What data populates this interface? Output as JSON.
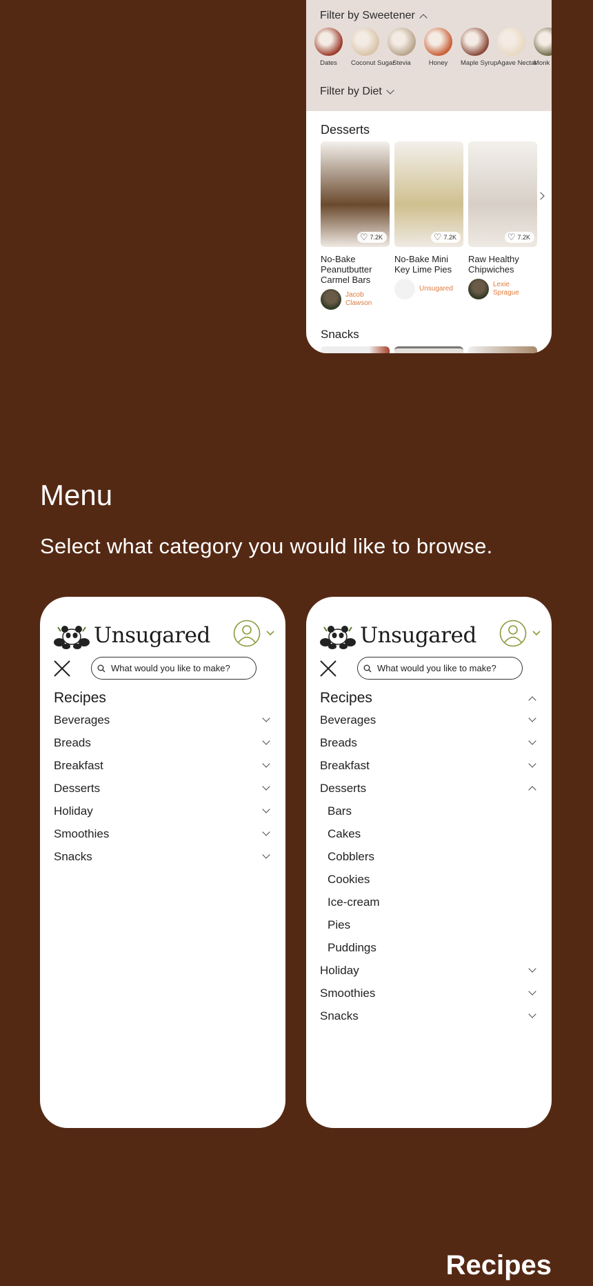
{
  "top_screen": {
    "filter_sweetener_label": "Filter by Sweetener",
    "filter_diet_label": "Filter by Diet",
    "sweeteners": [
      {
        "label": "Dates",
        "color": "#9c3b2c"
      },
      {
        "label": "Coconut Sugar",
        "color": "#d9c4a8"
      },
      {
        "label": "Stevia",
        "color": "#b7a48c"
      },
      {
        "label": "Honey",
        "color": "#c95f36"
      },
      {
        "label": "Maple Syrup",
        "color": "#8a4a3a"
      },
      {
        "label": "Agave Nectar",
        "color": "#e9d8c2"
      },
      {
        "label": "Monk Fruit",
        "color": "#6e6a48"
      }
    ],
    "desserts_title": "Desserts",
    "recipes": [
      {
        "title": "No-Bake Peanutbutter Carmel Bars",
        "likes": "7.2K",
        "author": "Jacob Clawson",
        "color": "#6b4a2e"
      },
      {
        "title": "No-Bake Mini Key Lime Pies",
        "likes": "7.2K",
        "author": "Unsugared",
        "color": "#cfc08f"
      },
      {
        "title": "Raw Healthy Chipwiches",
        "likes": "7.2K",
        "author": "Lexie Sprague",
        "color": "#d7cfc7"
      }
    ],
    "snacks_title": "Snacks"
  },
  "section": {
    "title": "Menu",
    "subtitle": "Select what category you would like to browse.",
    "next_title": "Recipes"
  },
  "app": {
    "logo_text": "Unsugared",
    "search_placeholder": "What would you like to make?",
    "accent_color": "#8a9a3c"
  },
  "menu_collapsed": {
    "heading": "Recipes",
    "items": [
      "Beverages",
      "Breads",
      "Breakfast",
      "Desserts",
      "Holiday",
      "Smoothies",
      "Snacks"
    ]
  },
  "menu_expanded": {
    "heading": "Recipes",
    "items_before": [
      "Beverages",
      "Breads",
      "Breakfast"
    ],
    "expanded_item": "Desserts",
    "sub_items": [
      "Bars",
      "Cakes",
      "Cobblers",
      "Cookies",
      "Ice-cream",
      "Pies",
      "Puddings"
    ],
    "items_after": [
      "Holiday",
      "Smoothies",
      "Snacks"
    ]
  }
}
